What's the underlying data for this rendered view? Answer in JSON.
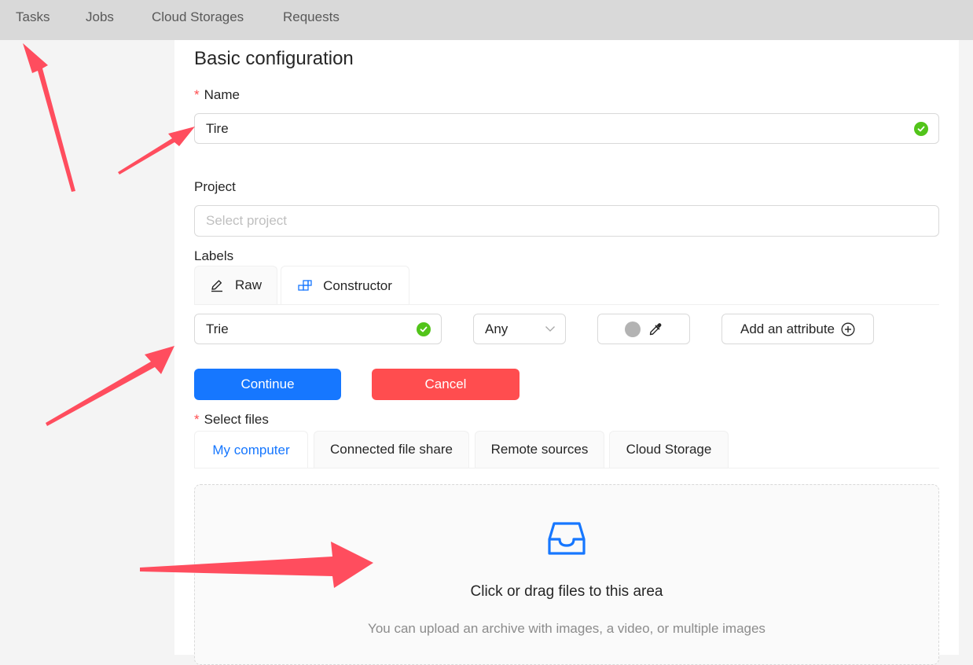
{
  "nav": {
    "items": [
      {
        "label": "Tasks"
      },
      {
        "label": "Jobs"
      },
      {
        "label": "Cloud Storages"
      },
      {
        "label": "Requests"
      }
    ]
  },
  "form": {
    "section_title": "Basic configuration",
    "name": {
      "label": "Name",
      "required_mark": "*",
      "value": "Tire"
    },
    "project": {
      "label": "Project",
      "placeholder": "Select project"
    },
    "labels": {
      "label": "Labels",
      "tabs": [
        {
          "label": "Raw",
          "icon": "edit-icon"
        },
        {
          "label": "Constructor",
          "icon": "build-icon"
        }
      ],
      "label_name_value": "Trie",
      "type_select_value": "Any",
      "add_attribute_label": "Add an attribute"
    },
    "continue_label": "Continue",
    "cancel_label": "Cancel",
    "select_files": {
      "label": "Select files",
      "required_mark": "*",
      "tabs": [
        {
          "label": "My computer"
        },
        {
          "label": "Connected file share"
        },
        {
          "label": "Remote sources"
        },
        {
          "label": "Cloud Storage"
        }
      ],
      "drop_title": "Click or drag files to this area",
      "drop_hint": "You can upload an archive with images, a video, or multiple images"
    }
  },
  "colors": {
    "primary": "#1677ff",
    "danger": "#ff4d4f",
    "success": "#52c41a",
    "annotation_arrow": "#ff4d5e"
  }
}
